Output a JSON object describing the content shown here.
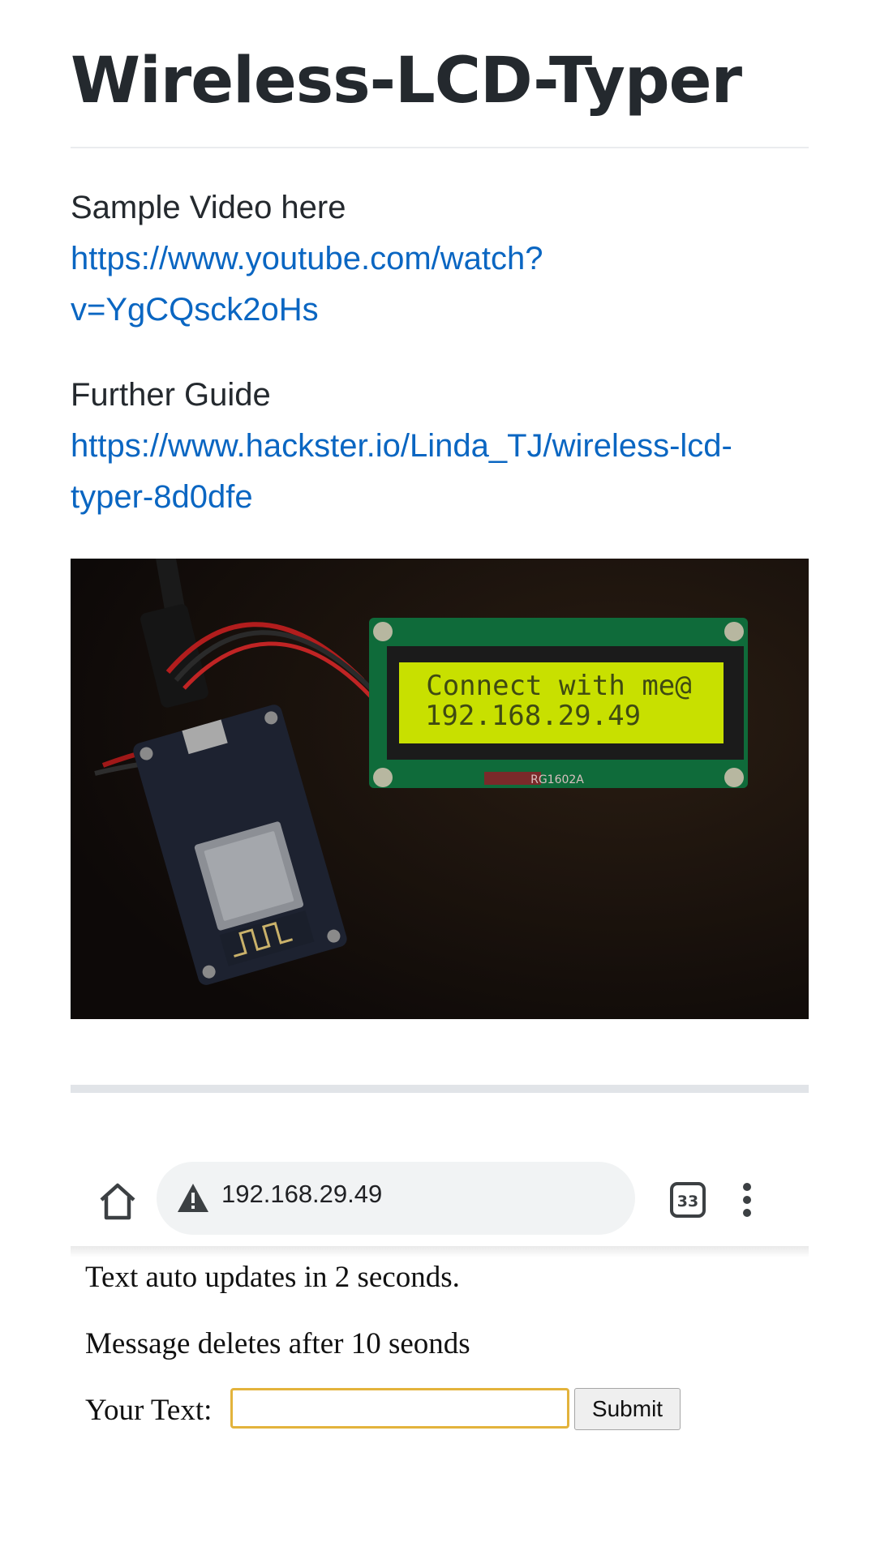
{
  "header": {
    "title": "Wireless-LCD-Typer"
  },
  "intro": {
    "sample_label": "Sample Video here",
    "sample_link_line1": "https://www.youtube.com/watch?",
    "sample_link_line2": "v=YgCQsck2oHs",
    "guide_label": "Further Guide",
    "guide_link_line1": "https://www.hackster.io/Linda_TJ/wireless-lcd-",
    "guide_link_line2": "typer-8d0dfe"
  },
  "photo": {
    "lcd_line1": "Connect with me@",
    "lcd_line2": "192.168.29.49",
    "lcd_model": "RG1602A"
  },
  "browser": {
    "url": "192.168.29.49",
    "tab_count": "33",
    "page": {
      "line1": "Text auto updates in 2 seconds.",
      "line2": "Message deletes after 10 seonds",
      "input_label": "Your Text:",
      "input_value": "",
      "submit_label": "Submit"
    }
  },
  "colors": {
    "link": "#0a66c2",
    "input_border": "#e3b33c",
    "lcd_backlight": "#c8e000"
  }
}
